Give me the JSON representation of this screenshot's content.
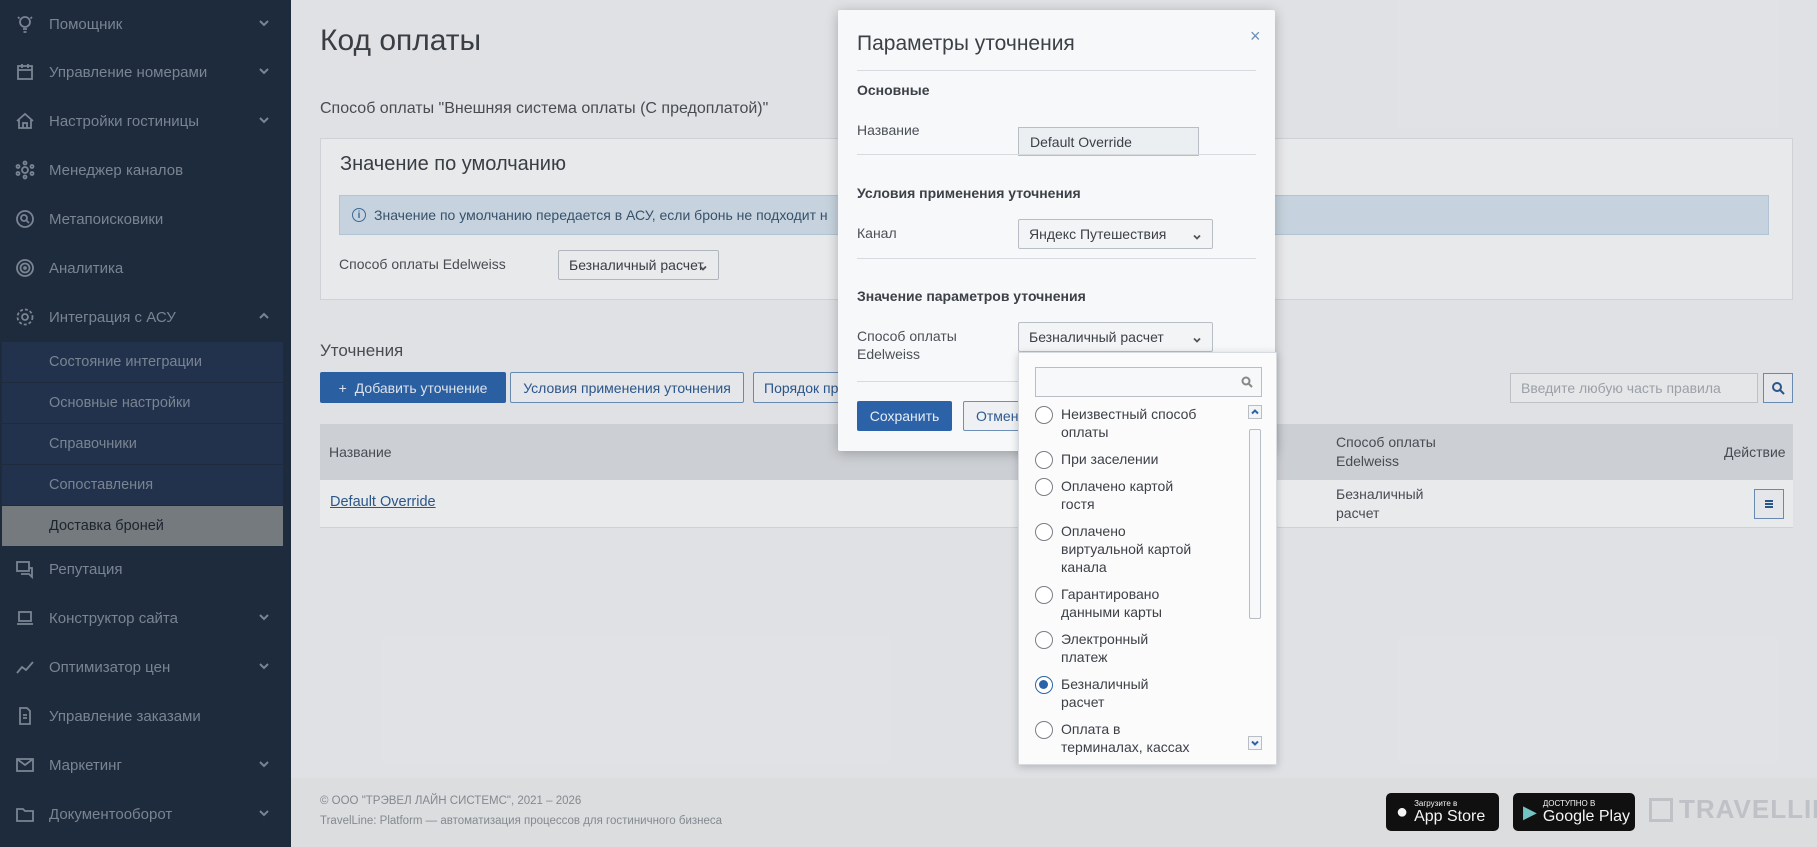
{
  "sidebar": {
    "items": [
      {
        "label": "Помощник",
        "icon": "bulb-icon",
        "chevron": true
      },
      {
        "label": "Управление номерами",
        "icon": "calendar-icon",
        "chevron": true
      },
      {
        "label": "Настройки гостиницы",
        "icon": "house-icon",
        "chevron": true
      },
      {
        "label": "Менеджер каналов",
        "icon": "network-icon",
        "chevron": false
      },
      {
        "label": "Метапоисковики",
        "icon": "target-search-icon",
        "chevron": false
      },
      {
        "label": "Аналитика",
        "icon": "radar-icon",
        "chevron": false
      },
      {
        "label": "Интеграция с АСУ",
        "icon": "gear-icon",
        "chevron": true
      }
    ],
    "subitems": [
      {
        "label": "Состояние интеграции"
      },
      {
        "label": "Основные настройки"
      },
      {
        "label": "Справочники"
      },
      {
        "label": "Сопоставления"
      },
      {
        "label": "Доставка броней"
      }
    ],
    "items_bottom": [
      {
        "label": "Репутация",
        "icon": "chat-icon",
        "chevron": false
      },
      {
        "label": "Конструктор сайта",
        "icon": "laptop-icon",
        "chevron": true
      },
      {
        "label": "Оптимизатор цен",
        "icon": "chart-line-icon",
        "chevron": true
      },
      {
        "label": "Управление заказами",
        "icon": "document-icon",
        "chevron": false
      },
      {
        "label": "Маркетинг",
        "icon": "mail-icon",
        "chevron": true
      },
      {
        "label": "Документооборот",
        "icon": "folder-icon",
        "chevron": true
      }
    ]
  },
  "main": {
    "title": "Код оплаты",
    "subtitle": "Способ оплаты \"Внешняя система оплаты (С предоплатой)\"",
    "default_card": {
      "title": "Значение по умолчанию",
      "info": "Значение по умолчанию передается в АСУ, если бронь не подходит н",
      "field_label": "Способ оплаты Edelweiss",
      "field_value": "Безналичный расчет"
    },
    "refinements": {
      "title": "Уточнения",
      "add_button": "Добавить уточнение",
      "conditions_button": "Условия применения уточнения",
      "order_button": "Порядок пр",
      "search_placeholder": "Введите любую часть правила",
      "table": {
        "col_name": "Название",
        "col_payment_line1": "Способ оплаты",
        "col_payment_line2": "Edelweiss",
        "col_action": "Действие",
        "rows": [
          {
            "name": "Default Override",
            "payment_line1": "Безналичный",
            "payment_line2": "расчет"
          }
        ]
      }
    },
    "footer": {
      "copyright": "© ООО \"ТРЭВЕЛ ЛАЙН СИСТЕМС\", 2021 – 2026",
      "tagline": "TravelLine: Platform — автоматизация процессов для гостиничного бизнеса",
      "appstore_small": "Загрузите в",
      "appstore_big": "App Store",
      "googleplay_small": "ДОСТУПНО В",
      "googleplay_big": "Google Play",
      "brand": "TRAVELLINE"
    }
  },
  "modal": {
    "title": "Параметры уточнения",
    "close": "×",
    "section_main": "Основные",
    "name_label": "Название",
    "name_value": "Default Override",
    "section_conditions": "Условия применения уточнения",
    "channel_label": "Канал",
    "channel_value": "Яндекс Путешествия",
    "section_values": "Значение параметров уточнения",
    "payment_label_line1": "Способ оплаты",
    "payment_label_line2": "Edelweiss",
    "payment_value": "Безналичный расчет",
    "save_button": "Сохранить",
    "cancel_button": "Отмен"
  },
  "dropdown": {
    "options": [
      {
        "line1": "Неизвестный способ",
        "line2": "оплаты",
        "checked": false
      },
      {
        "line1": "При заселении",
        "line2": "",
        "checked": false
      },
      {
        "line1": "Оплачено картой",
        "line2": "гостя",
        "checked": false
      },
      {
        "line1": "Оплачено",
        "line2": "виртуальной картой",
        "line3": "канала",
        "checked": false
      },
      {
        "line1": "Гарантировано",
        "line2": "данными карты",
        "checked": false
      },
      {
        "line1": "Электронный",
        "line2": "платеж",
        "checked": false
      },
      {
        "line1": "Безналичный",
        "line2": "расчет",
        "checked": true
      },
      {
        "line1": "Оплата в",
        "line2": "терминалах, кассах",
        "checked": false
      }
    ]
  },
  "colors": {
    "sidebar_bg": "#1f2d3f",
    "primary": "#2c63a8",
    "active_sub_bg": "#7a7f85"
  }
}
